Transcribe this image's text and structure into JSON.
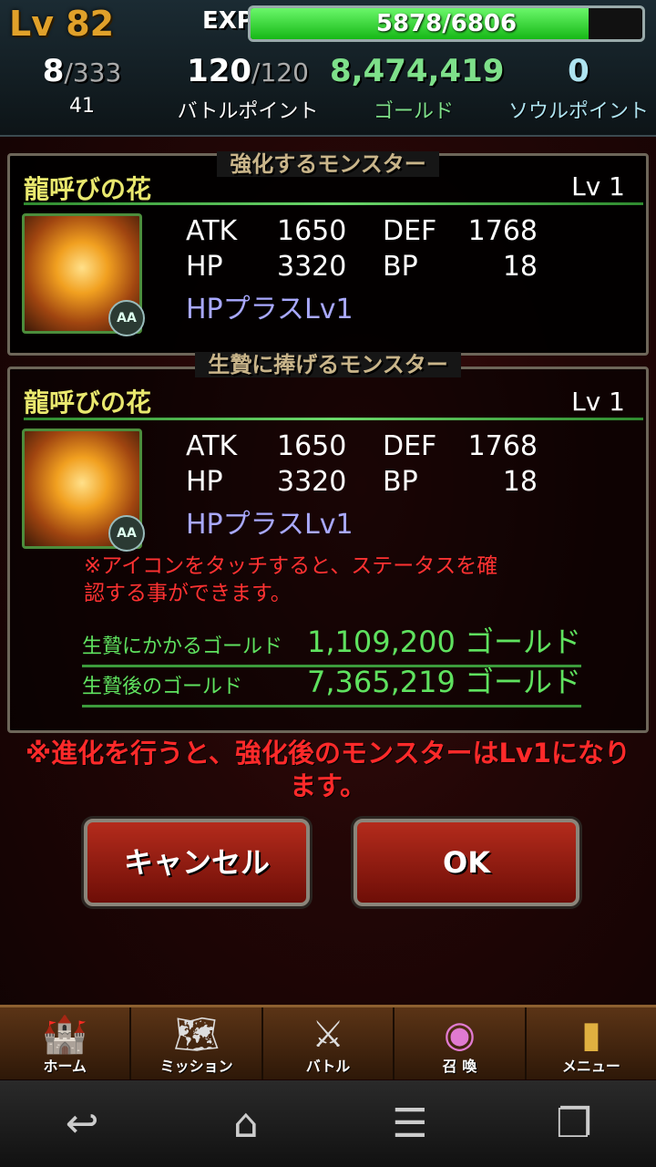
{
  "header": {
    "level": "Lv 82",
    "exp_label": "EXP",
    "exp_text": "5878/6806",
    "exp_fraction": 0.8636,
    "stats": [
      {
        "value": "8",
        "max": "/333",
        "label": "41"
      },
      {
        "value": "120",
        "max": "/120",
        "label": "バトルポイント"
      },
      {
        "value": "8,474,419",
        "max": "",
        "label": "ゴールド"
      },
      {
        "value": "0",
        "max": "",
        "label": "ソウルポイント"
      }
    ],
    "colors": {
      "gold": "#7ee08a",
      "soul": "#aee3f0",
      "level": "#e0a12a"
    }
  },
  "enhance": {
    "title": "強化するモンスター",
    "monster": {
      "name": "龍呼びの花",
      "level": "Lv 1",
      "rank": "AA",
      "atk_label": "ATK",
      "atk": "1650",
      "def_label": "DEF",
      "def": "1768",
      "hp_label": "HP",
      "hp": "3320",
      "bp_label": "BP",
      "bp": "18",
      "skill": "HPプラスLv1"
    }
  },
  "sacrifice": {
    "title": "生贄に捧げるモンスター",
    "monster": {
      "name": "龍呼びの花",
      "level": "Lv 1",
      "rank": "AA",
      "atk_label": "ATK",
      "atk": "1650",
      "def_label": "DEF",
      "def": "1768",
      "hp_label": "HP",
      "hp": "3320",
      "bp_label": "BP",
      "bp": "18",
      "skill": "HPプラスLv1"
    },
    "note_line1": "※アイコンをタッチすると、ステータスを確",
    "note_line2": "認する事ができます。",
    "cost_label": "生贄にかかるゴールド",
    "cost_value": "1,109,200 ゴールド",
    "after_label": "生贄後のゴールド",
    "after_value": "7,365,219 ゴールド"
  },
  "warning_line1": "※進化を行うと、強化後のモンスターはLv1になり",
  "warning_line2": "ます。",
  "buttons": {
    "cancel": "キャンセル",
    "ok": "OK"
  },
  "game_nav": [
    {
      "label": "ホーム",
      "icon": "castle-icon"
    },
    {
      "label": "ミッション",
      "icon": "map-icon"
    },
    {
      "label": "バトル",
      "icon": "axe-icon"
    },
    {
      "label": "召 喚",
      "icon": "portal-icon"
    },
    {
      "label": "メニュー",
      "icon": "book-icon"
    }
  ],
  "system_nav": [
    {
      "icon": "back-icon"
    },
    {
      "icon": "home-icon"
    },
    {
      "icon": "menu-icon"
    },
    {
      "icon": "recent-apps-icon"
    }
  ]
}
